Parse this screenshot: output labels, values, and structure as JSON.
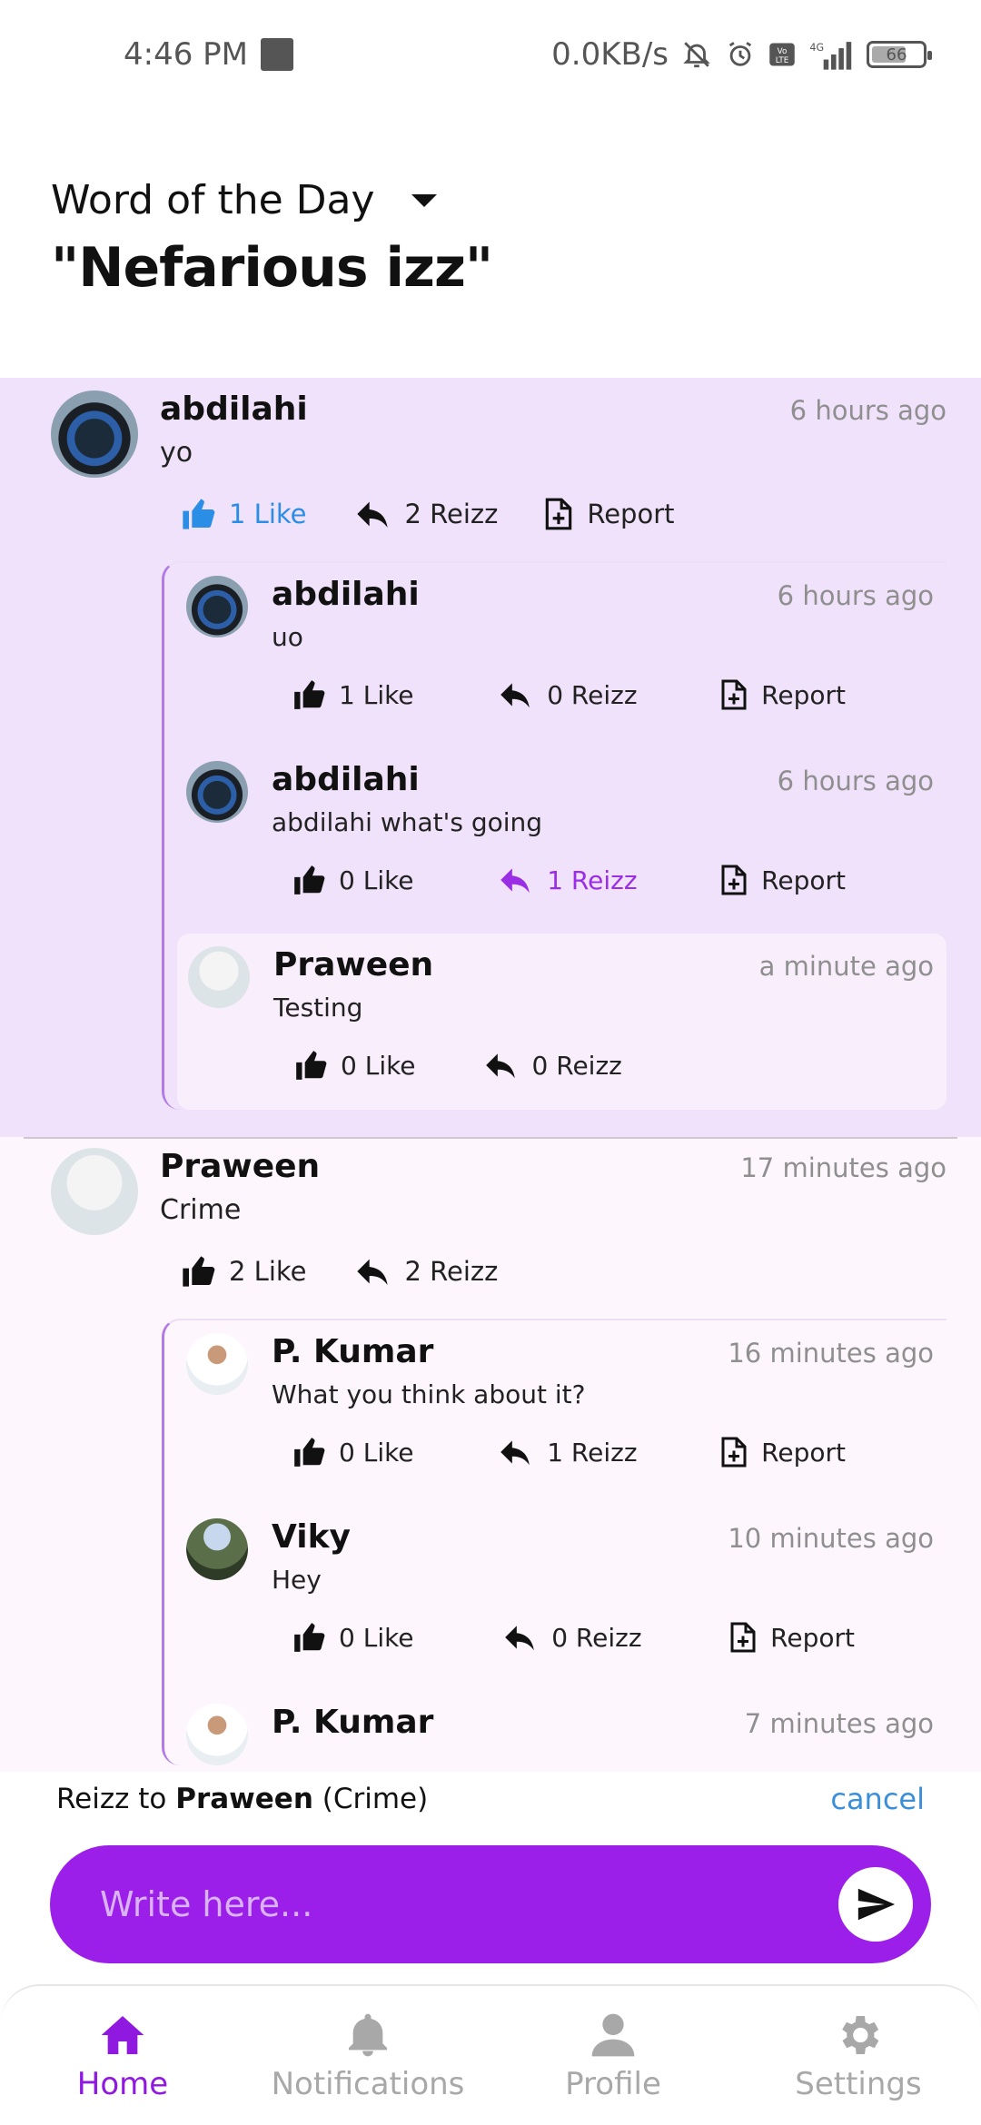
{
  "status_bar": {
    "time": "4:46 PM",
    "net_speed": "0.0KB/s",
    "network": "4G",
    "battery": "66"
  },
  "header": {
    "label": "Word of the Day",
    "word": "\"Nefarious izz\""
  },
  "threads": [
    {
      "comment": {
        "name": "abdilahi",
        "time": "6 hours ago",
        "text": "yo",
        "like": "1 Like",
        "reizz": "2 Reizz",
        "report": "Report"
      },
      "replies": [
        {
          "name": "abdilahi",
          "time": "6 hours ago",
          "text": "uo",
          "like": "1 Like",
          "reizz": "0 Reizz",
          "report": "Report"
        },
        {
          "name": "abdilahi",
          "time": "6 hours ago",
          "text": "abdilahi what's going",
          "like": "0 Like",
          "reizz": "1 Reizz",
          "report": "Report"
        },
        {
          "name": "Praween",
          "time": "a minute ago",
          "text": "Testing",
          "like": "0 Like",
          "reizz": "0 Reizz"
        }
      ]
    },
    {
      "comment": {
        "name": "Praween",
        "time": "17 minutes ago",
        "text": "Crime",
        "like": "2 Like",
        "reizz": "2 Reizz"
      },
      "replies": [
        {
          "name": "P. Kumar",
          "time": "16 minutes ago",
          "text": "What you think about it?",
          "like": "0 Like",
          "reizz": "1 Reizz",
          "report": "Report"
        },
        {
          "name": "Viky",
          "time": "10 minutes ago",
          "text": "Hey",
          "like": "0 Like",
          "reizz": "0 Reizz",
          "report": "Report"
        },
        {
          "name": "P. Kumar",
          "time": "7 minutes ago"
        }
      ]
    }
  ],
  "reply_bar": {
    "prefix": "Reizz to",
    "target_name": "Praween",
    "target_comment": "(Crime)",
    "cancel": "cancel"
  },
  "composer": {
    "placeholder": "Write here..."
  },
  "nav": {
    "home": "Home",
    "notifications": "Notifications",
    "profile": "Profile",
    "settings": "Settings"
  },
  "colors": {
    "accent": "#9b1fe8",
    "highlight_bg": "#f0e2fb",
    "like_active": "#2b8ee6",
    "link": "#3b8fd8"
  }
}
